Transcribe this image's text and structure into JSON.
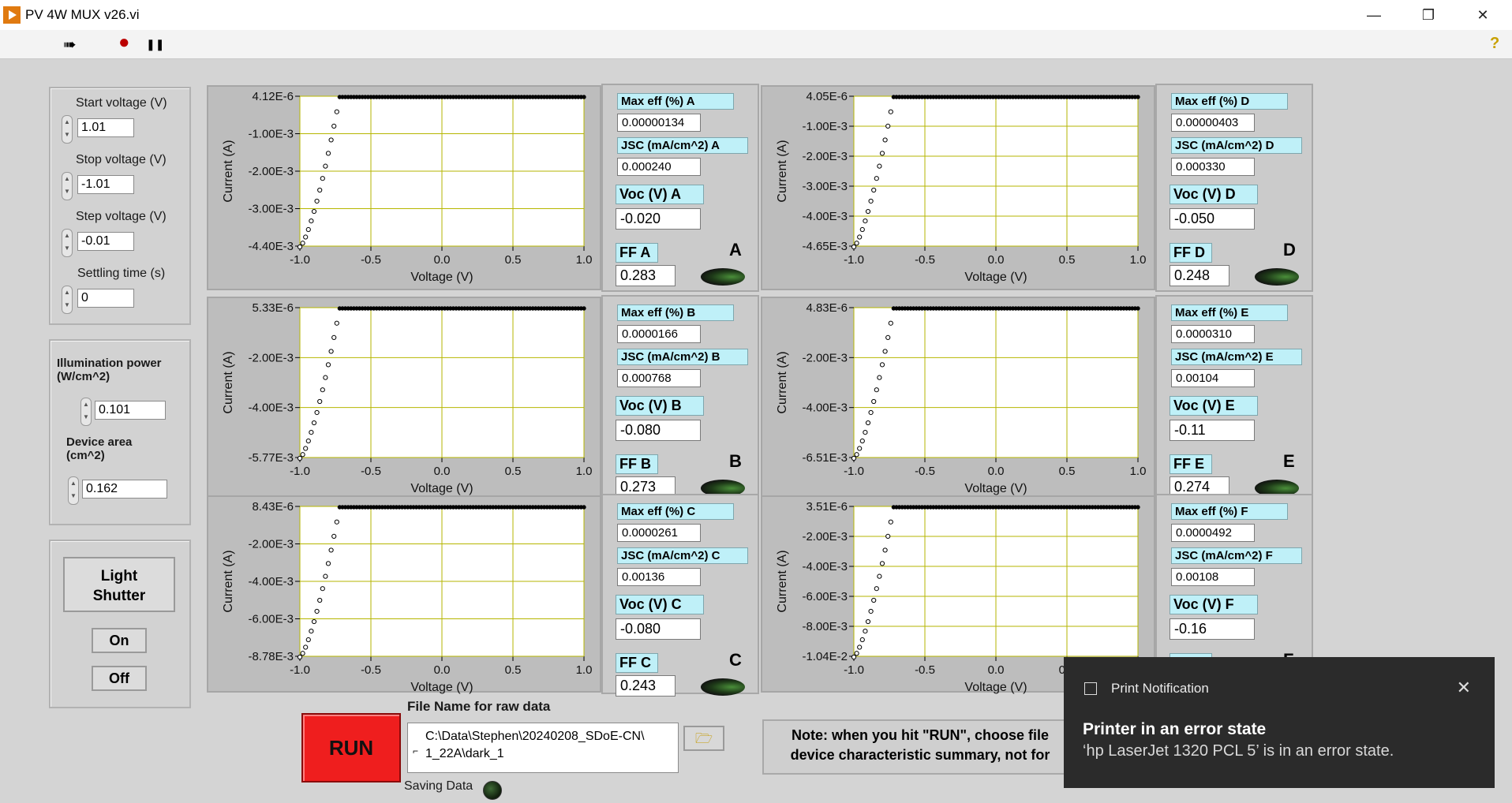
{
  "window": {
    "title": "PV 4W MUX v26.vi",
    "minimize": "—",
    "maximize": "❐",
    "close": "✕"
  },
  "toolbar": {
    "run_arrow": "➠",
    "abort": "●",
    "pause": "❚❚",
    "help": "?"
  },
  "sweep": {
    "start_label": "Start voltage (V)",
    "start_value": "1.01",
    "stop_label": "Stop voltage (V)",
    "stop_value": "-1.01",
    "step_label": "Step voltage (V)",
    "step_value": "-0.01",
    "settle_label": "Settling time (s)",
    "settle_value": "0"
  },
  "illum": {
    "power_label": "Illumination power (W/cm^2)",
    "power_value": "0.101",
    "area_label": "Device area (cm^2)",
    "area_value": "0.162"
  },
  "shutter": {
    "label_line1": "Light",
    "label_line2": "Shutter",
    "on": "On",
    "off": "Off"
  },
  "axis": {
    "xlabel": "Voltage (V)",
    "ylabel": "Current (A)",
    "xticks": [
      "-1.0",
      "-0.5",
      "0.0",
      "0.5",
      "1.0"
    ]
  },
  "channels": [
    {
      "id": "A",
      "yticks": [
        "4.12E-6",
        "-1.00E-3",
        "-2.00E-3",
        "-3.00E-3",
        "-4.40E-3"
      ],
      "max_eff_label": "Max eff (%) A",
      "max_eff": "0.00000134",
      "jsc_label": "JSC (mA/cm^2) A",
      "jsc": "0.000240",
      "voc_label": "Voc (V) A",
      "voc": "-0.020",
      "ff_label": "FF A",
      "ff": "0.283",
      "letter": "A"
    },
    {
      "id": "D",
      "yticks": [
        "4.05E-6",
        "-1.00E-3",
        "-2.00E-3",
        "-3.00E-3",
        "-4.00E-3",
        "-4.65E-3"
      ],
      "max_eff_label": "Max eff (%) D",
      "max_eff": "0.00000403",
      "jsc_label": "JSC (mA/cm^2) D",
      "jsc": "0.000330",
      "voc_label": "Voc (V) D",
      "voc": "-0.050",
      "ff_label": "FF D",
      "ff": "0.248",
      "letter": "D"
    },
    {
      "id": "B",
      "yticks": [
        "5.33E-6",
        "-2.00E-3",
        "-4.00E-3",
        "-5.77E-3"
      ],
      "max_eff_label": "Max eff (%) B",
      "max_eff": "0.0000166",
      "jsc_label": "JSC (mA/cm^2) B",
      "jsc": "0.000768",
      "voc_label": "Voc (V) B",
      "voc": "-0.080",
      "ff_label": "FF B",
      "ff": "0.273",
      "letter": "B"
    },
    {
      "id": "E",
      "yticks": [
        "4.83E-6",
        "-2.00E-3",
        "-4.00E-3",
        "-6.51E-3"
      ],
      "max_eff_label": "Max eff (%) E",
      "max_eff": "0.0000310",
      "jsc_label": "JSC (mA/cm^2) E",
      "jsc": "0.00104",
      "voc_label": "Voc (V) E",
      "voc": "-0.11",
      "ff_label": "FF E",
      "ff": "0.274",
      "letter": "E"
    },
    {
      "id": "C",
      "yticks": [
        "8.43E-6",
        "-2.00E-3",
        "-4.00E-3",
        "-6.00E-3",
        "-8.78E-3"
      ],
      "max_eff_label": "Max eff (%) C",
      "max_eff": "0.0000261",
      "jsc_label": "JSC (mA/cm^2) C",
      "jsc": "0.00136",
      "voc_label": "Voc (V) C",
      "voc": "-0.080",
      "ff_label": "FF C",
      "ff": "0.243",
      "letter": "C"
    },
    {
      "id": "F",
      "yticks": [
        "3.51E-6",
        "-2.00E-3",
        "-4.00E-3",
        "-6.00E-3",
        "-8.00E-3",
        "-1.04E-2"
      ],
      "max_eff_label": "Max eff (%) F",
      "max_eff": "0.0000492",
      "jsc_label": "JSC (mA/cm^2) F",
      "jsc": "0.00108",
      "voc_label": "Voc (V) F",
      "voc": "-0.16",
      "ff_label": "FF F",
      "ff": "",
      "letter": "F"
    }
  ],
  "file": {
    "label": "File Name for raw data",
    "path_line1": "C:\\Data\\Stephen\\20240208_SDoE-CN\\",
    "path_line2": "1_22A\\dark_1",
    "folder_icon": "🗁"
  },
  "run_button": {
    "label": "RUN"
  },
  "saving": {
    "label": "Saving Data"
  },
  "note": {
    "line1": "Note: when you hit \"RUN\", choose file",
    "line2": "device characteristic summary, not for"
  },
  "toast": {
    "app": "Print Notification",
    "title": "Printer in an error state",
    "body": "‘hp LaserJet 1320 PCL 5’ is in an error state.",
    "close": "✕"
  },
  "colors": {
    "run": "#ef1e1e",
    "plot_bg": "#ffffff",
    "grid": "#b6b600",
    "indicator_label": "#bff0f8",
    "toast_bg": "#2b2b2b"
  }
}
